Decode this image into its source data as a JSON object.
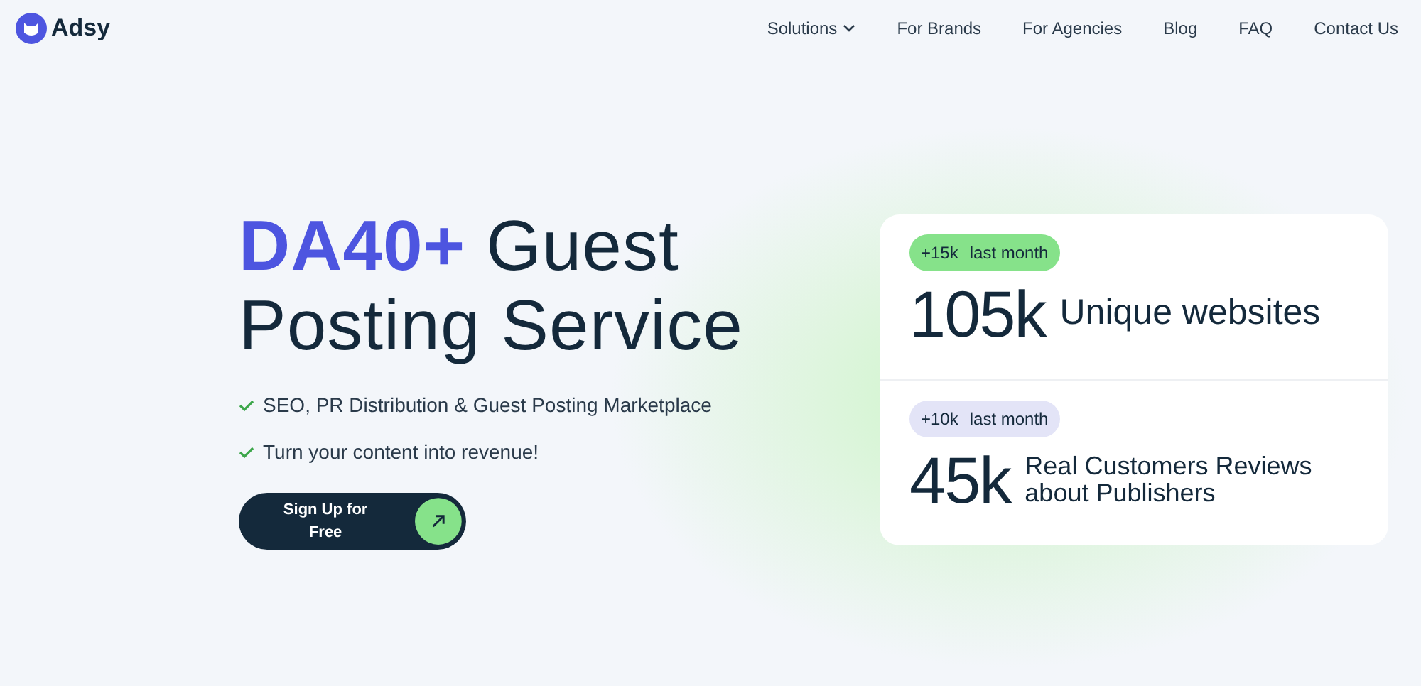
{
  "logo": {
    "text": "Adsy"
  },
  "nav": [
    {
      "label": "Solutions",
      "kind": "dropdown"
    },
    {
      "label": "For Brands",
      "kind": "link"
    },
    {
      "label": "For Agencies",
      "kind": "link"
    },
    {
      "label": "Blog",
      "kind": "link"
    },
    {
      "label": "FAQ",
      "kind": "link"
    },
    {
      "label": "Contact Us",
      "kind": "link"
    }
  ],
  "hero": {
    "title_highlight": "DA40+",
    "title_rest": "Guest Posting Service",
    "features": [
      "SEO, PR Distribution & Guest Posting Marketplace",
      "Turn your content into revenue!"
    ],
    "cta": "Sign Up for Free"
  },
  "stats": [
    {
      "badge_value": "+15k",
      "badge_text": "last month",
      "color": "#86e28a",
      "number": "105k",
      "label": "Unique websites"
    },
    {
      "badge_value": "+10k",
      "badge_text": "last month",
      "color": "#e3e4f7",
      "number": "45k",
      "label": "Real Customers Reviews about Publishers"
    }
  ]
}
